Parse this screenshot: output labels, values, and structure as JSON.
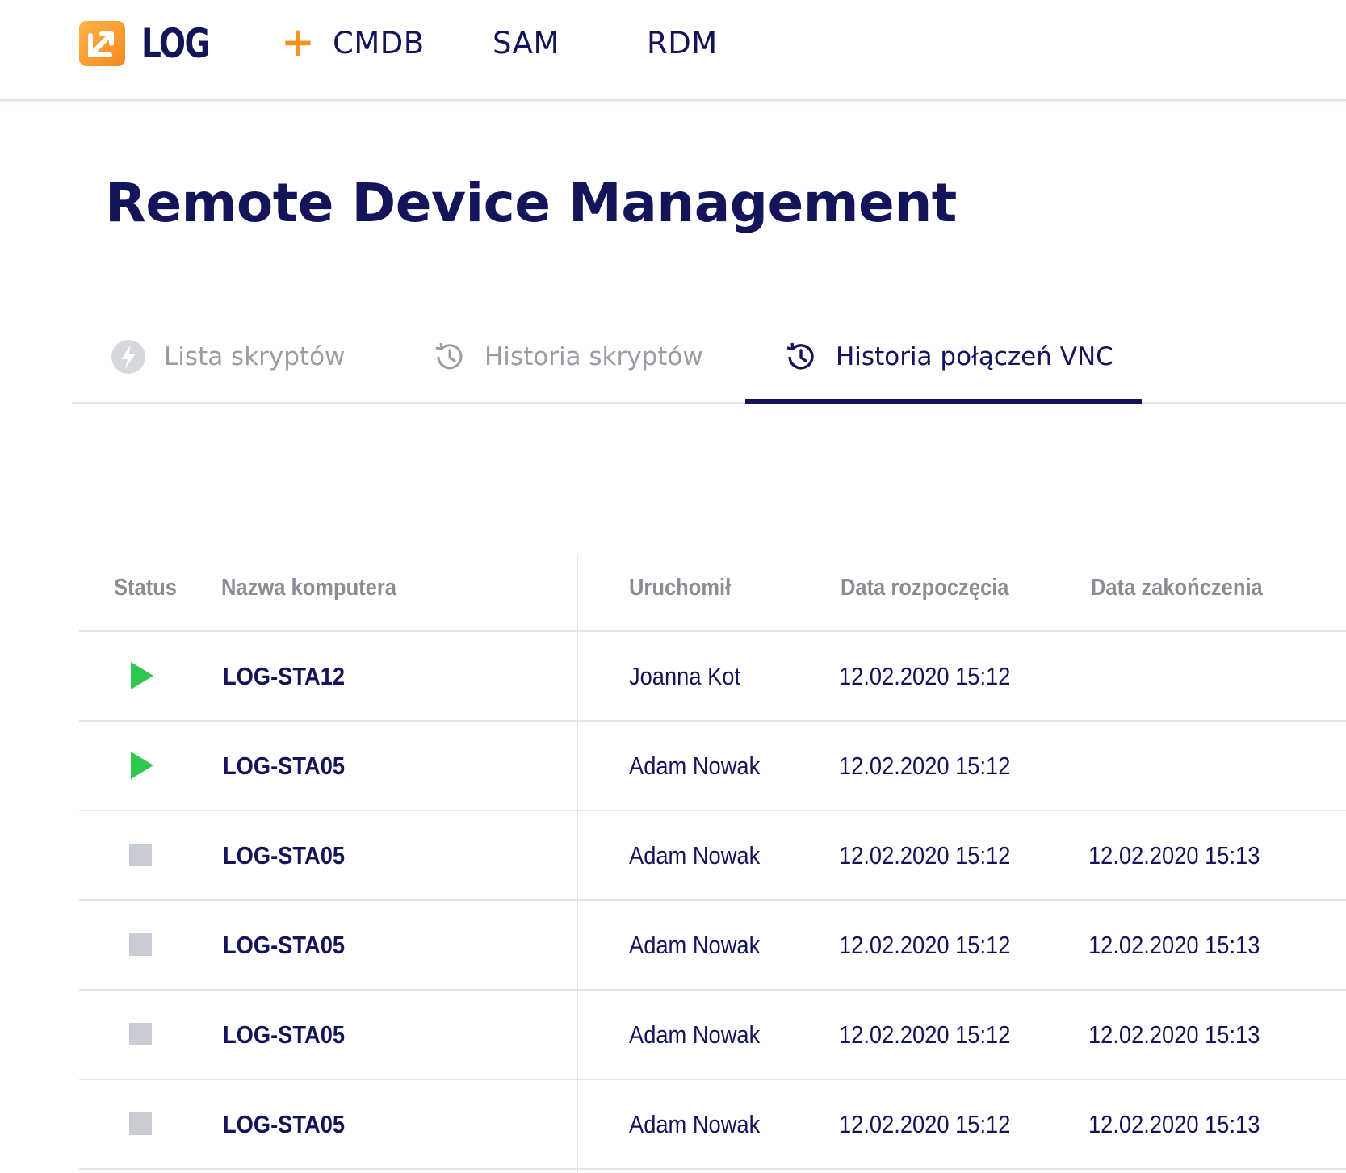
{
  "brand": {
    "name": "LOG",
    "plus": "+"
  },
  "nav": {
    "items": [
      "CMDB",
      "SAM",
      "RDM"
    ]
  },
  "page": {
    "title": "Remote Device Management"
  },
  "tabs": [
    {
      "label": "Lista skryptów",
      "icon": "lightning-icon",
      "active": false
    },
    {
      "label": "Historia skryptów",
      "icon": "history-icon",
      "active": false
    },
    {
      "label": "Historia połączeń VNC",
      "icon": "history-icon",
      "active": true
    }
  ],
  "table": {
    "columns": [
      "Status",
      "Nazwa komputera",
      "Uruchomił",
      "Data rozpoczęcia",
      "Data zakończenia"
    ],
    "rows": [
      {
        "status": "running",
        "computer": "LOG-STA12",
        "started_by": "Joanna Kot",
        "start": "12.02.2020 15:12",
        "end": ""
      },
      {
        "status": "running",
        "computer": "LOG-STA05",
        "started_by": "Adam Nowak",
        "start": "12.02.2020 15:12",
        "end": ""
      },
      {
        "status": "stopped",
        "computer": "LOG-STA05",
        "started_by": "Adam Nowak",
        "start": "12.02.2020 15:12",
        "end": "12.02.2020 15:13"
      },
      {
        "status": "stopped",
        "computer": "LOG-STA05",
        "started_by": "Adam Nowak",
        "start": "12.02.2020 15:12",
        "end": "12.02.2020 15:13"
      },
      {
        "status": "stopped",
        "computer": "LOG-STA05",
        "started_by": "Adam Nowak",
        "start": "12.02.2020 15:12",
        "end": "12.02.2020 15:13"
      },
      {
        "status": "stopped",
        "computer": "LOG-STA05",
        "started_by": "Adam Nowak",
        "start": "12.02.2020 15:12",
        "end": "12.02.2020 15:13"
      }
    ]
  },
  "colors": {
    "primary": "#14145a",
    "accent": "#f7941d",
    "running": "#2dc84d",
    "stopped": "#c8ccd3",
    "muted": "#9a9ca3"
  }
}
